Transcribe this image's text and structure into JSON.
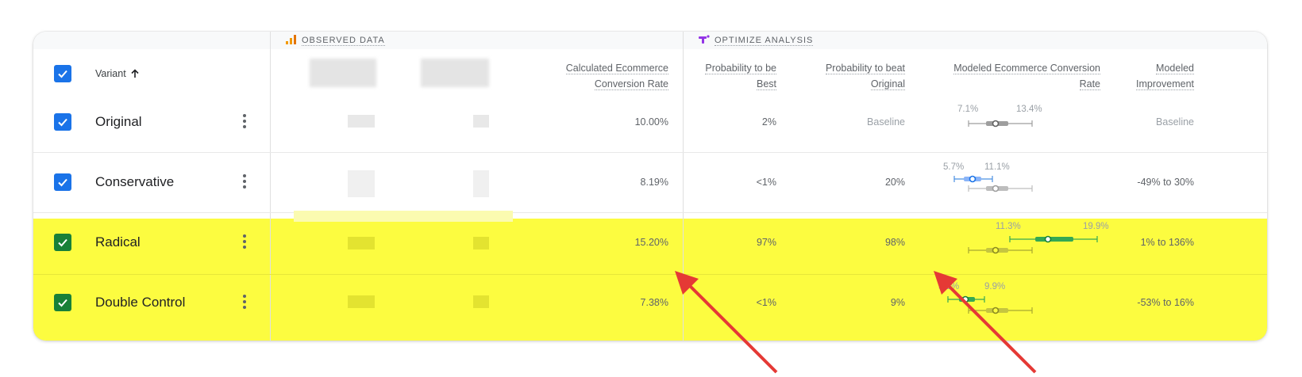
{
  "groups": {
    "observed_label": "OBSERVED DATA",
    "analysis_label": "OPTIMIZE ANALYSIS"
  },
  "header": {
    "variant_label": "Variant",
    "calc_rate_line1": "Calculated Ecommerce",
    "calc_rate_line2": "Conversion Rate",
    "prob_best_line1": "Probability to be",
    "prob_best_line2": "Best",
    "prob_beat_line1": "Probability to beat",
    "prob_beat_line2": "Original",
    "modeled_rate_line1": "Modeled Ecommerce Conversion",
    "modeled_rate_line2": "Rate",
    "modeled_impr_line1": "Modeled",
    "modeled_impr_line2": "Improvement"
  },
  "rows": [
    {
      "name": "Original",
      "calc_rate": "10.00%",
      "prob_best": "2%",
      "prob_beat": "Baseline",
      "ci_low": "7.1%",
      "ci_high": "13.4%",
      "improvement": "Baseline",
      "highlighted": false
    },
    {
      "name": "Conservative",
      "calc_rate": "8.19%",
      "prob_best": "<1%",
      "prob_beat": "20%",
      "ci_low": "5.7%",
      "ci_high": "11.1%",
      "improvement": "-49% to 30%",
      "highlighted": false
    },
    {
      "name": "Radical",
      "calc_rate": "15.20%",
      "prob_best": "97%",
      "prob_beat": "98%",
      "ci_low": "11.3%",
      "ci_high": "19.9%",
      "improvement": "1% to 136%",
      "highlighted": true
    },
    {
      "name": "Double Control",
      "calc_rate": "7.38%",
      "prob_best": "<1%",
      "prob_beat": "9%",
      "ci_low": "5.2%",
      "ci_high": "9.9%",
      "improvement": "-53% to 16%",
      "highlighted": true
    }
  ],
  "colors": {
    "checkbox_blue": "#1a73e8",
    "checkbox_green": "#188038",
    "highlight": "#fcfc40",
    "arrow": "#e53935",
    "observed_icon": "#f29900",
    "analysis_icon": "#9334e6"
  },
  "icons": {
    "observed": "bar-chart-icon",
    "analysis": "optimize-icon",
    "sort": "arrow-up-icon",
    "check": "check-icon",
    "more": "more-vert-icon"
  }
}
